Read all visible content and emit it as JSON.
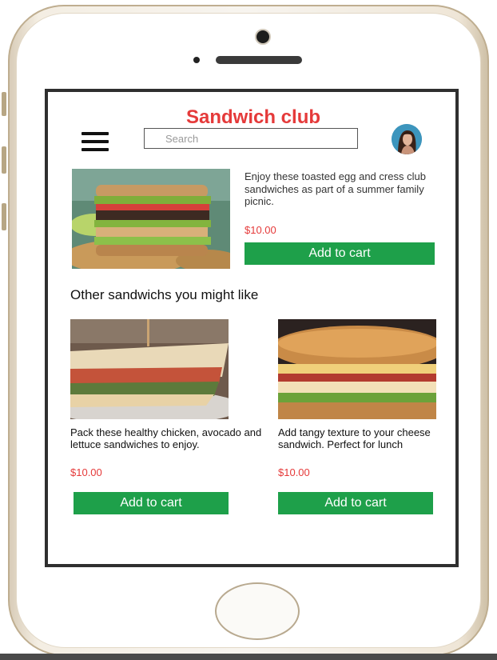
{
  "app": {
    "title": "Sandwich club",
    "search": {
      "placeholder": "Search",
      "value": ""
    }
  },
  "featured": {
    "description": "Enjoy these toasted egg and cress club sandwiches as part of a summer family picnic.",
    "price": "$10.00",
    "add_to_cart_label": "Add to cart"
  },
  "recommendations": {
    "heading": "Other sandwichs you might like",
    "items": [
      {
        "description": "Pack these healthy chicken, avocado and lettuce sandwiches to enjoy.",
        "price": "$10.00",
        "add_to_cart_label": "Add to cart"
      },
      {
        "description": "Add tangy texture to your cheese sandwich. Perfect for lunch",
        "price": "$10.00",
        "add_to_cart_label": "Add to cart"
      }
    ]
  },
  "colors": {
    "title": "#e53a3a",
    "price": "#e53a3a",
    "button": "#1ea04a",
    "frame": "#2f2f2f"
  },
  "icons": [
    "hamburger-menu-icon",
    "avatar"
  ]
}
